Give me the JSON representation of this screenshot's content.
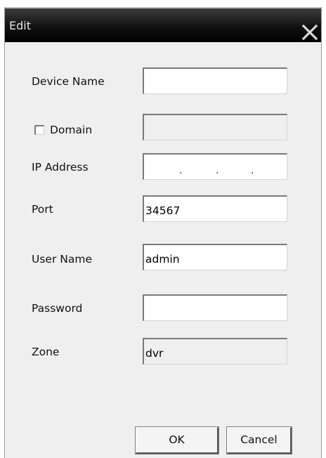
{
  "window": {
    "title": "Edit"
  },
  "form": {
    "device_name": {
      "label": "Device Name",
      "value": ""
    },
    "domain": {
      "label": "Domain",
      "checked": false,
      "value": ""
    },
    "ip_address": {
      "label": "IP Address",
      "value": "",
      "separator": "."
    },
    "port": {
      "label": "Port",
      "value": "34567"
    },
    "user_name": {
      "label": "User Name",
      "value": "admin"
    },
    "password": {
      "label": "Password",
      "value": ""
    },
    "zone": {
      "label": "Zone",
      "value": "dvr"
    }
  },
  "buttons": {
    "ok_label": "OK",
    "cancel_label": "Cancel"
  },
  "icons": {
    "close": "close-icon",
    "checkbox": "checkbox-icon"
  },
  "colors": {
    "titlebar": "#000000",
    "dialog_background": "#efefef",
    "field_background": "#ffffff",
    "disabled_field_background": "#efefef"
  }
}
